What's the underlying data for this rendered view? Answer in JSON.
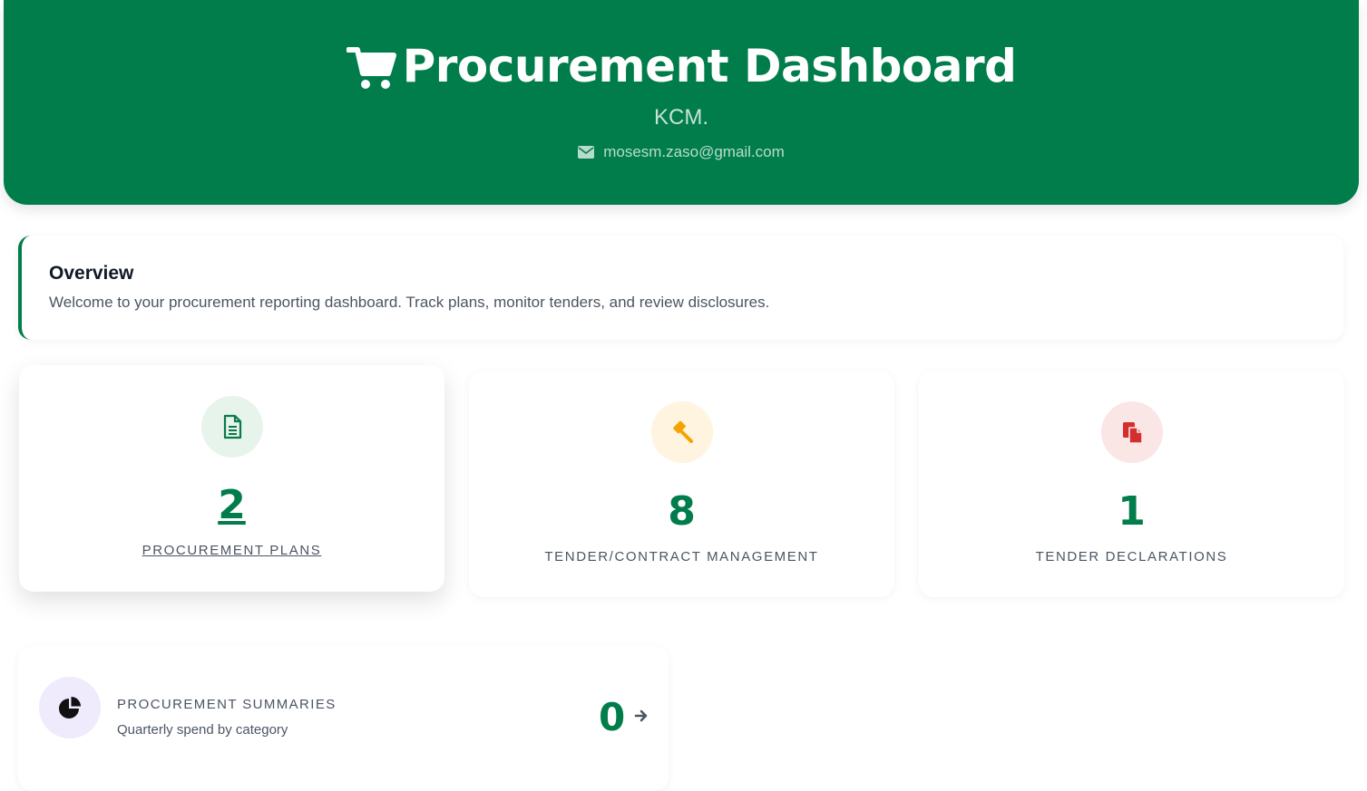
{
  "header": {
    "title": "Procurement Dashboard",
    "organization": "KCM.",
    "email": "mosesm.zaso@gmail.com",
    "icons": {
      "title": "shopping-cart-icon",
      "email": "envelope-icon"
    }
  },
  "overview": {
    "title": "Overview",
    "description": "Welcome to your procurement reporting dashboard. Track plans, monitor tenders, and review disclosures."
  },
  "cards": [
    {
      "count": "2",
      "label": "PROCUREMENT PLANS",
      "icon": "document-icon",
      "icon_color": "#0a7a4a",
      "icon_bg": "#e6f4ec"
    },
    {
      "count": "8",
      "label": "TENDER/CONTRACT MANAGEMENT",
      "icon": "gavel-icon",
      "icon_color": "#f5a300",
      "icon_bg": "#fff4e0"
    },
    {
      "count": "1",
      "label": "TENDER DECLARATIONS",
      "icon": "copy-documents-icon",
      "icon_color": "#d32f2f",
      "icon_bg": "#fbe6e6"
    }
  ],
  "summary": {
    "title": "PROCUREMENT SUMMARIES",
    "subtitle": "Quarterly spend by category",
    "count": "0",
    "icon": "pie-chart-icon",
    "arrow_icon": "arrow-right-icon"
  },
  "colors": {
    "brand": "#007d4a",
    "text_muted": "#4b5563",
    "heading": "#111827"
  }
}
